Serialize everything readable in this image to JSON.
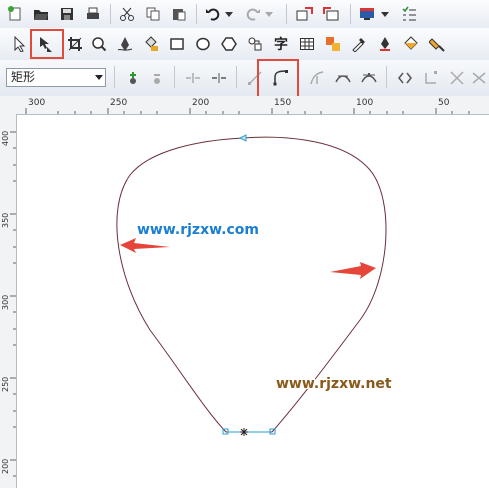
{
  "property_bar": {
    "shape_select": "矩形"
  },
  "ruler_top": {
    "labels": [
      "300",
      "250",
      "200",
      "150",
      "100",
      "50"
    ]
  },
  "ruler_left": {
    "labels": [
      "400",
      "350",
      "300",
      "250",
      "200"
    ]
  },
  "watermarks": {
    "primary": "www.rjzxw.com",
    "secondary": "www.rjzxw.net"
  },
  "icon_text": {
    "text_tool": "字"
  },
  "colors": {
    "highlight": "#e24a3c",
    "curve": "#6b2f3a",
    "node": "#2a9fd6",
    "arrow": "#e6453a"
  }
}
